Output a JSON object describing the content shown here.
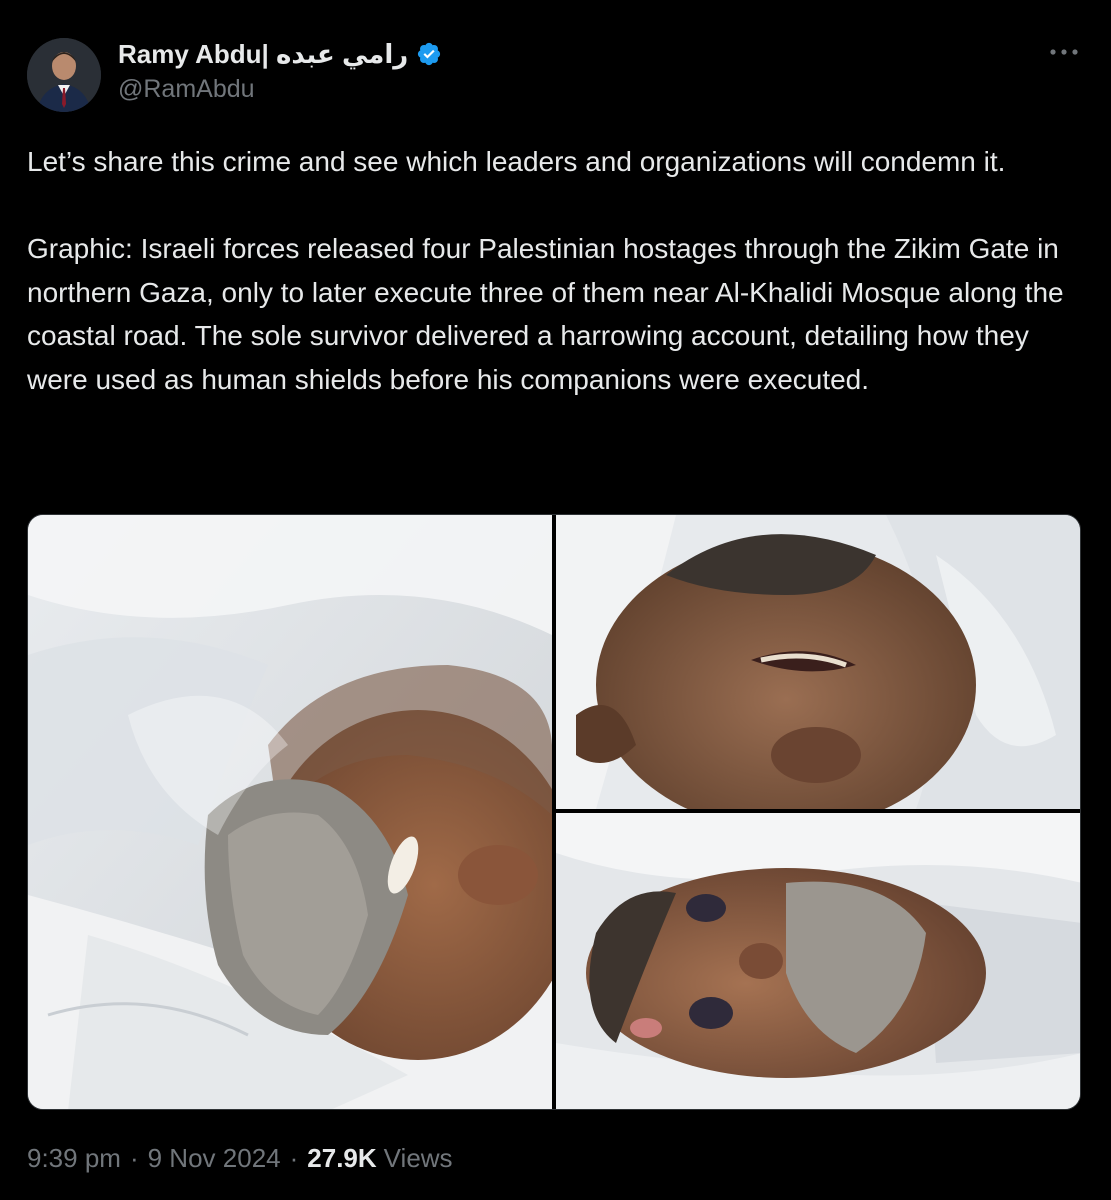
{
  "author": {
    "display_name": "Ramy Abdu| رامي عبده",
    "handle": "@RamAbdu",
    "verified": true,
    "avatar_icon": "profile-photo"
  },
  "tweet": {
    "text": "Let’s share this crime and see which leaders and organizations will condemn it.\n\nGraphic: Israeli forces released four Palestinian hostages through the Zikim Gate in northern Gaza, only to later execute three of them near Al-Khalidi Mosque along the coastal road. The sole survivor delivered a harrowing account, detailing how they were used as human shields before his companions were executed."
  },
  "media": {
    "count": 3,
    "photos": [
      {
        "id": "photo-1"
      },
      {
        "id": "photo-2"
      },
      {
        "id": "photo-3"
      }
    ]
  },
  "meta": {
    "time": "9:39 pm",
    "separator": "·",
    "date": "9 Nov 2024",
    "views_count": "27.9K",
    "views_label": "Views"
  },
  "icons": {
    "more": "more-horizontal-icon",
    "verified": "verified-badge-icon"
  },
  "colors": {
    "background": "#000000",
    "text_primary": "#e7e9ea",
    "text_secondary": "#71767b",
    "verified_blue": "#1d9bf0",
    "border": "#2f3336"
  }
}
